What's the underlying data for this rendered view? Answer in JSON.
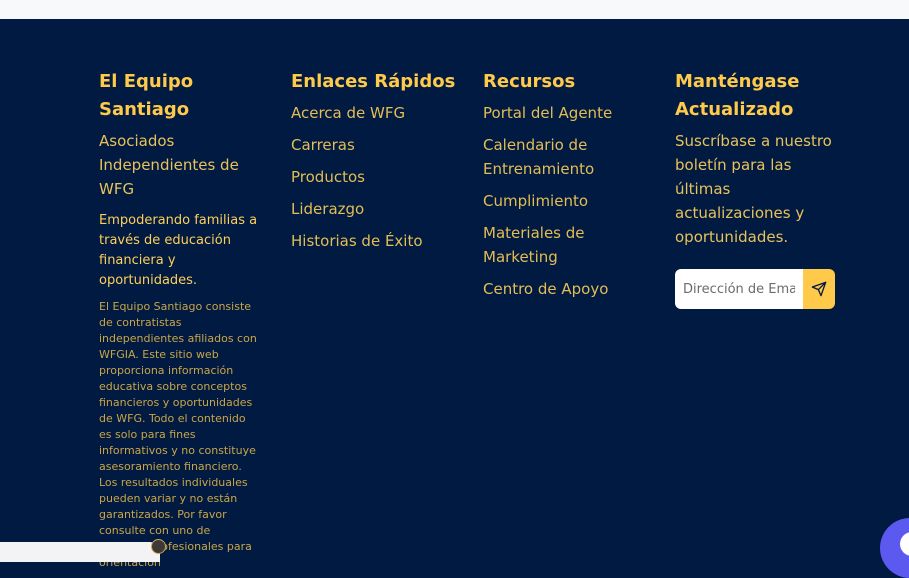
{
  "brand": {
    "title": "El Equipo Santiago",
    "subtitle": "Asociados Independientes de WFG",
    "mission": "Empoderando familias a través de educación financiera y oportunidades.",
    "disclaimer": "El Equipo Santiago consiste de contratistas independientes afiliados con WFGIA. Este sitio web proporciona información educativa sobre conceptos financieros y oportunidades de WFG. Todo el contenido es solo para fines informativos y no constituye asesoramiento financiero. Los resultados individuales pueden variar y no están garantizados. Por favor consulte con uno de nuestros profesionales para orientación"
  },
  "quick_links": {
    "heading": "Enlaces Rápidos",
    "items": [
      "Acerca de WFG",
      "Carreras",
      "Productos",
      "Liderazgo",
      "Historias de Éxito"
    ]
  },
  "resources": {
    "heading": "Recursos",
    "items": [
      "Portal del Agente",
      "Calendario de Entrenamiento",
      "Cumplimiento",
      "Materiales de Marketing",
      "Centro de Apoyo"
    ]
  },
  "newsletter": {
    "heading": "Manténgase Actualizado",
    "text": "Suscríbase a nuestro boletín para las últimas actualizaciones y oportunidades.",
    "email_placeholder": "Dirección de Email",
    "send_icon": "send-icon"
  },
  "colors": {
    "background": "#001a41",
    "accent": "#ffc94a",
    "link": "#e3bd55"
  }
}
